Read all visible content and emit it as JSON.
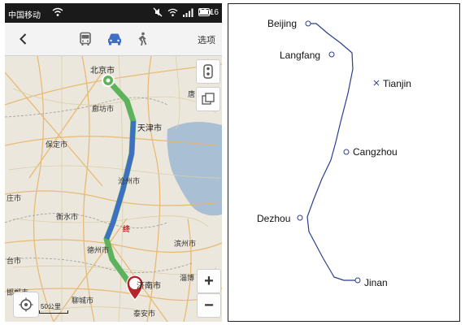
{
  "status_bar": {
    "carrier": "中国移动",
    "time": "20:16",
    "icons": [
      "wifi-icon",
      "mute-icon",
      "signal-icon",
      "battery-icon"
    ]
  },
  "toolbar": {
    "back_icon": "chevron-left-icon",
    "modes": [
      {
        "name": "bus",
        "icon": "bus-icon",
        "active": false
      },
      {
        "name": "car",
        "icon": "car-icon",
        "active": true
      },
      {
        "name": "walk",
        "icon": "walk-icon",
        "active": false
      }
    ],
    "options_label": "选项"
  },
  "map": {
    "cities": [
      {
        "id": "beijing",
        "label": "北京市"
      },
      {
        "id": "langfang",
        "label": "廊坊市"
      },
      {
        "id": "tianjin",
        "label": "天津市"
      },
      {
        "id": "tangshan",
        "label": "唐山市"
      },
      {
        "id": "baoding",
        "label": "保定市"
      },
      {
        "id": "cangzhou",
        "label": "沧州市"
      },
      {
        "id": "hengshui",
        "label": "衡水市"
      },
      {
        "id": "dezhou",
        "label": "德州市"
      },
      {
        "id": "binzhou",
        "label": "滨州市"
      },
      {
        "id": "liaocheng",
        "label": "聊城市"
      },
      {
        "id": "jinan",
        "label": "济南市"
      },
      {
        "id": "taian",
        "label": "泰安市"
      },
      {
        "id": "zibo",
        "label": "淄博"
      },
      {
        "id": "shijiazhuang",
        "label": "庄市"
      },
      {
        "id": "xingtai",
        "label": "台市"
      },
      {
        "id": "handan",
        "label": "邯郸市"
      }
    ],
    "end_marker": "终",
    "scale_label": "50公里",
    "zoom_in": "+",
    "zoom_out": "−",
    "accent_route": "#3e6fc4",
    "accent_route_alt": "#5cb35c"
  },
  "diagram": {
    "cities": [
      {
        "id": "beijing",
        "label": "Beijing",
        "marker": "circle"
      },
      {
        "id": "langfang",
        "label": "Langfang",
        "marker": "circle"
      },
      {
        "id": "tianjin",
        "label": "Tianjin",
        "marker": "cross"
      },
      {
        "id": "cangzhou",
        "label": "Cangzhou",
        "marker": "circle"
      },
      {
        "id": "dezhou",
        "label": "Dezhou",
        "marker": "circle"
      },
      {
        "id": "jinan",
        "label": "Jinan",
        "marker": "circle"
      }
    ],
    "route_color": "#2b3f8c"
  }
}
